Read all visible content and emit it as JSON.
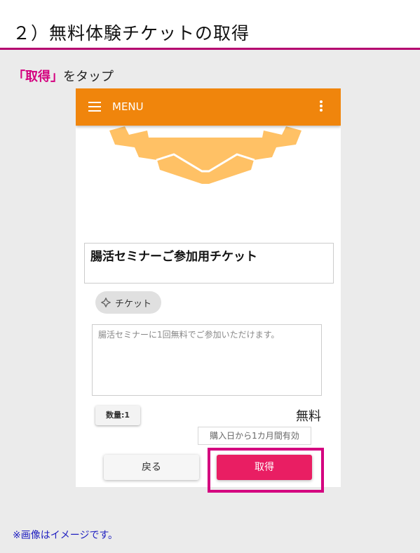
{
  "page": {
    "title": "２）無料体験チケットの取得",
    "instruction_em": "「取得」",
    "instruction_rest": "をタップ",
    "note": "※画像はイメージです。"
  },
  "app": {
    "appbar": {
      "menu_label": "MENU",
      "menu_icon": "hamburger-icon",
      "overflow_icon": "more-vert-icon"
    },
    "ticket": {
      "name": "腸活セミナーご参加用チケット",
      "chip_label": "チケット",
      "chip_icon": "ticket-icon",
      "description": "腸活セミナーに1回無料でご参加いただけます。",
      "quantity_label": "数量:1",
      "price": "無料",
      "validity": "購入日から1カ月間有効"
    },
    "buttons": {
      "back": "戻る",
      "get": "取得"
    }
  },
  "colors": {
    "appbar": "#f0850c",
    "primary_button": "#e91e63",
    "highlight": "#d4007f",
    "accent_line": "#b5006f",
    "ticket_art": "#ffc165"
  }
}
